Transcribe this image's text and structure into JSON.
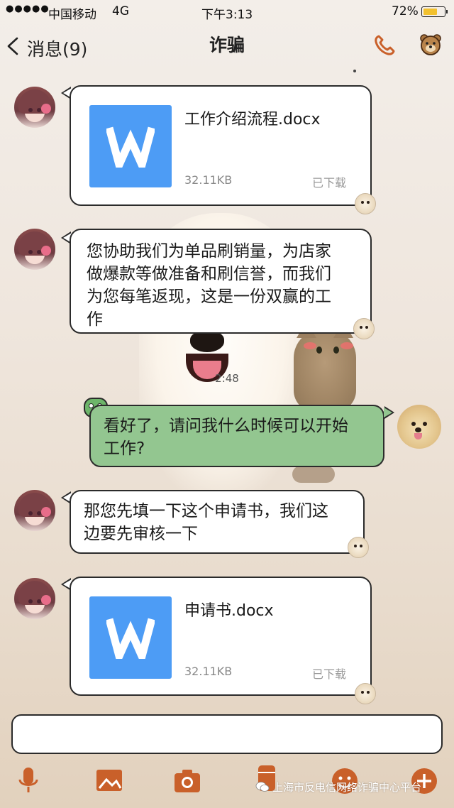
{
  "status_bar": {
    "signal": "●●●●●",
    "carrier": "中国移动",
    "network": "4G",
    "time": "下午3:13",
    "battery_percent": "72%",
    "battery_level": 0.72,
    "battery_color": "#f2c12e"
  },
  "nav": {
    "back_label": "消息(9)",
    "title": "诈骗",
    "call_icon": "phone-icon",
    "profile_icon": "bear-avatar-icon"
  },
  "timestamp": "2:48",
  "messages": [
    {
      "type": "file",
      "side": "left",
      "file_name": "工作介绍流程.docx",
      "file_size": "32.11KB",
      "status": "已下载"
    },
    {
      "type": "text",
      "side": "left",
      "lines": [
        "您协助我们为单品刷销量，为店家",
        "做爆款等做准备和刷信誉，而我们",
        "为您每笔返现，这是一份双赢的工",
        "作"
      ]
    },
    {
      "type": "text",
      "side": "right",
      "lines": [
        "看好了，请问我什么时候可以开始",
        "工作?"
      ]
    },
    {
      "type": "text",
      "side": "left",
      "lines": [
        "那您先填一下这个申请书，我们这",
        "边要先审核一下"
      ]
    },
    {
      "type": "file",
      "side": "left",
      "file_name": "申请书.docx",
      "file_size": "32.11KB",
      "status": "已下载"
    }
  ],
  "input": {
    "value": "",
    "placeholder": ""
  },
  "toolbar": {
    "items": [
      "microphone-icon",
      "image-icon",
      "camera-icon",
      "wallet-icon",
      "emoji-icon",
      "plus-icon"
    ]
  },
  "watermark": "上海市反电信网络诈骗中心平台",
  "colors": {
    "file_blue": "#4d9cf5",
    "outgoing_green": "#93c690",
    "accent_orange": "#c9602a",
    "bubble_border": "#2b2b2b"
  }
}
